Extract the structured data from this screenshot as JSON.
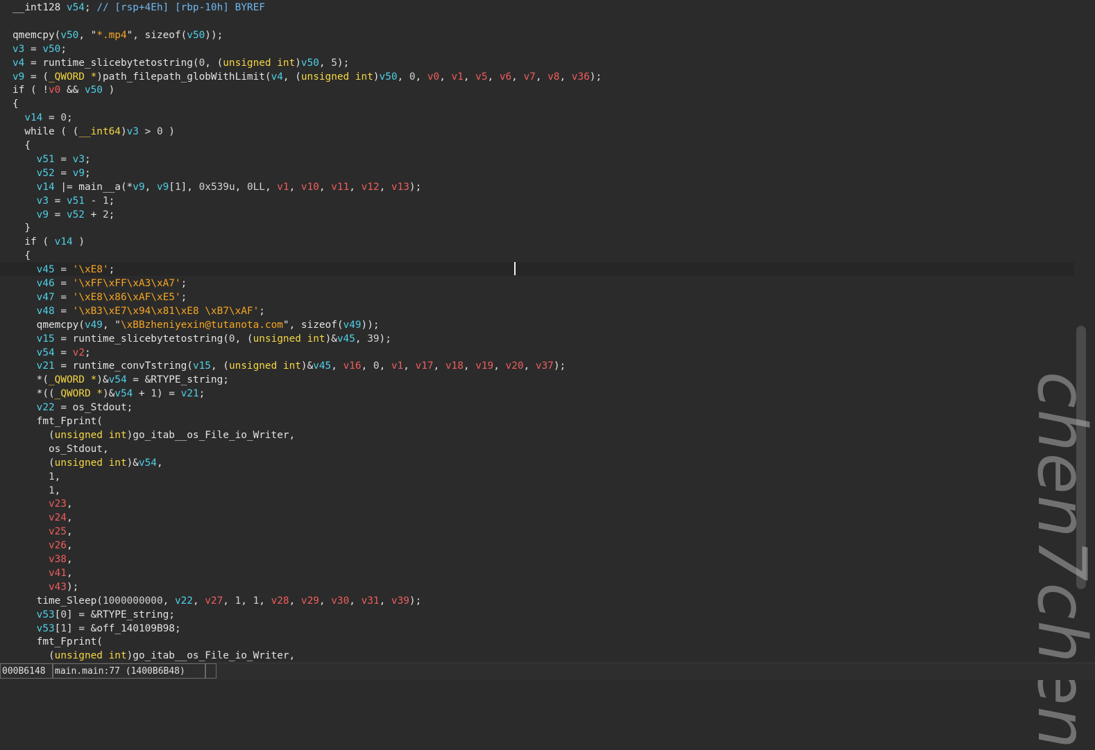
{
  "editor": {
    "lines": [
      [
        [
          "t-plain",
          "__int128 "
        ],
        [
          "t-local",
          "v54"
        ],
        [
          "t-plain",
          "; "
        ],
        [
          "t-cmt",
          "// [rsp+4Eh] [rbp-10h] BYREF"
        ]
      ],
      [],
      [
        [
          "t-plain",
          "qmemcpy("
        ],
        [
          "t-local",
          "v50"
        ],
        [
          "t-plain",
          ", \""
        ],
        [
          "t-str",
          "*.mp4"
        ],
        [
          "t-plain",
          "\", sizeof("
        ],
        [
          "t-local",
          "v50"
        ],
        [
          "t-plain",
          "));"
        ]
      ],
      [
        [
          "t-local",
          "v3"
        ],
        [
          "t-plain",
          " = "
        ],
        [
          "t-local",
          "v50"
        ],
        [
          "t-plain",
          ";"
        ]
      ],
      [
        [
          "t-local",
          "v4"
        ],
        [
          "t-plain",
          " = runtime_slicebytetostring("
        ],
        [
          "t-num",
          "0"
        ],
        [
          "t-plain",
          ", ("
        ],
        [
          "t-type",
          "unsigned int"
        ],
        [
          "t-plain",
          ")"
        ],
        [
          "t-local",
          "v50"
        ],
        [
          "t-plain",
          ", "
        ],
        [
          "t-num",
          "5"
        ],
        [
          "t-plain",
          ");"
        ]
      ],
      [
        [
          "t-local",
          "v9"
        ],
        [
          "t-plain",
          " = ("
        ],
        [
          "t-type",
          "_QWORD *"
        ],
        [
          "t-plain",
          ")path_filepath_globWithLimit("
        ],
        [
          "t-local",
          "v4"
        ],
        [
          "t-plain",
          ", ("
        ],
        [
          "t-type",
          "unsigned int"
        ],
        [
          "t-plain",
          ")"
        ],
        [
          "t-local",
          "v50"
        ],
        [
          "t-plain",
          ", "
        ],
        [
          "t-num",
          "0"
        ],
        [
          "t-plain",
          ", "
        ],
        [
          "t-arg",
          "v0"
        ],
        [
          "t-plain",
          ", "
        ],
        [
          "t-arg",
          "v1"
        ],
        [
          "t-plain",
          ", "
        ],
        [
          "t-arg",
          "v5"
        ],
        [
          "t-plain",
          ", "
        ],
        [
          "t-arg",
          "v6"
        ],
        [
          "t-plain",
          ", "
        ],
        [
          "t-arg",
          "v7"
        ],
        [
          "t-plain",
          ", "
        ],
        [
          "t-arg",
          "v8"
        ],
        [
          "t-plain",
          ", "
        ],
        [
          "t-arg",
          "v36"
        ],
        [
          "t-plain",
          ");"
        ]
      ],
      [
        [
          "t-plain",
          "if ( !"
        ],
        [
          "t-arg",
          "v0"
        ],
        [
          "t-plain",
          " && "
        ],
        [
          "t-local",
          "v50"
        ],
        [
          "t-plain",
          " )"
        ]
      ],
      [
        [
          "t-plain",
          "{"
        ]
      ],
      [
        [
          "t-plain",
          "  "
        ],
        [
          "t-local",
          "v14"
        ],
        [
          "t-plain",
          " = "
        ],
        [
          "t-num",
          "0"
        ],
        [
          "t-plain",
          ";"
        ]
      ],
      [
        [
          "t-plain",
          "  while ( ("
        ],
        [
          "t-type",
          "__int64"
        ],
        [
          "t-plain",
          ")"
        ],
        [
          "t-local",
          "v3"
        ],
        [
          "t-plain",
          " > "
        ],
        [
          "t-num",
          "0"
        ],
        [
          "t-plain",
          " )"
        ]
      ],
      [
        [
          "t-plain",
          "  {"
        ]
      ],
      [
        [
          "t-plain",
          "    "
        ],
        [
          "t-local",
          "v51"
        ],
        [
          "t-plain",
          " = "
        ],
        [
          "t-local",
          "v3"
        ],
        [
          "t-plain",
          ";"
        ]
      ],
      [
        [
          "t-plain",
          "    "
        ],
        [
          "t-local",
          "v52"
        ],
        [
          "t-plain",
          " = "
        ],
        [
          "t-local",
          "v9"
        ],
        [
          "t-plain",
          ";"
        ]
      ],
      [
        [
          "t-plain",
          "    "
        ],
        [
          "t-local",
          "v14"
        ],
        [
          "t-plain",
          " |= main__a(*"
        ],
        [
          "t-local",
          "v9"
        ],
        [
          "t-plain",
          ", "
        ],
        [
          "t-local",
          "v9"
        ],
        [
          "t-plain",
          "["
        ],
        [
          "t-num",
          "1"
        ],
        [
          "t-plain",
          "], "
        ],
        [
          "t-num",
          "0x539u"
        ],
        [
          "t-plain",
          ", "
        ],
        [
          "t-num",
          "0LL"
        ],
        [
          "t-plain",
          ", "
        ],
        [
          "t-arg",
          "v1"
        ],
        [
          "t-plain",
          ", "
        ],
        [
          "t-arg",
          "v10"
        ],
        [
          "t-plain",
          ", "
        ],
        [
          "t-arg",
          "v11"
        ],
        [
          "t-plain",
          ", "
        ],
        [
          "t-arg",
          "v12"
        ],
        [
          "t-plain",
          ", "
        ],
        [
          "t-arg",
          "v13"
        ],
        [
          "t-plain",
          ");"
        ]
      ],
      [
        [
          "t-plain",
          "    "
        ],
        [
          "t-local",
          "v3"
        ],
        [
          "t-plain",
          " = "
        ],
        [
          "t-local",
          "v51"
        ],
        [
          "t-plain",
          " - "
        ],
        [
          "t-num",
          "1"
        ],
        [
          "t-plain",
          ";"
        ]
      ],
      [
        [
          "t-plain",
          "    "
        ],
        [
          "t-local",
          "v9"
        ],
        [
          "t-plain",
          " = "
        ],
        [
          "t-local",
          "v52"
        ],
        [
          "t-plain",
          " + "
        ],
        [
          "t-num",
          "2"
        ],
        [
          "t-plain",
          ";"
        ]
      ],
      [
        [
          "t-plain",
          "  }"
        ]
      ],
      [
        [
          "t-plain",
          "  if ( "
        ],
        [
          "t-local",
          "v14"
        ],
        [
          "t-plain",
          " )"
        ]
      ],
      [
        [
          "t-plain",
          "  {"
        ]
      ],
      [
        [
          "t-plain",
          "    "
        ],
        [
          "t-local",
          "v45"
        ],
        [
          "t-plain",
          " = "
        ],
        [
          "t-str",
          "'\\xE8'"
        ],
        [
          "t-plain",
          ";"
        ]
      ],
      [
        [
          "t-plain",
          "    "
        ],
        [
          "t-local",
          "v46"
        ],
        [
          "t-plain",
          " = "
        ],
        [
          "t-str",
          "'\\xFF\\xFF\\xA3\\xA7'"
        ],
        [
          "t-plain",
          ";"
        ]
      ],
      [
        [
          "t-plain",
          "    "
        ],
        [
          "t-local",
          "v47"
        ],
        [
          "t-plain",
          " = "
        ],
        [
          "t-str",
          "'\\xE8\\x86\\xAF\\xE5'"
        ],
        [
          "t-plain",
          ";"
        ]
      ],
      [
        [
          "t-plain",
          "    "
        ],
        [
          "t-local",
          "v48"
        ],
        [
          "t-plain",
          " = "
        ],
        [
          "t-str",
          "'\\xB3\\xE7\\x94\\x81\\xE8 \\xB7\\xAF'"
        ],
        [
          "t-plain",
          ";"
        ]
      ],
      [
        [
          "t-plain",
          "    qmemcpy("
        ],
        [
          "t-local",
          "v49"
        ],
        [
          "t-plain",
          ", \""
        ],
        [
          "t-str",
          "\\xBBzheniyexin@tutanota.com"
        ],
        [
          "t-plain",
          "\", sizeof("
        ],
        [
          "t-local",
          "v49"
        ],
        [
          "t-plain",
          "));"
        ]
      ],
      [
        [
          "t-plain",
          "    "
        ],
        [
          "t-local",
          "v15"
        ],
        [
          "t-plain",
          " = runtime_slicebytetostring("
        ],
        [
          "t-num",
          "0"
        ],
        [
          "t-plain",
          ", ("
        ],
        [
          "t-type",
          "unsigned int"
        ],
        [
          "t-plain",
          ")&"
        ],
        [
          "t-local",
          "v45"
        ],
        [
          "t-plain",
          ", "
        ],
        [
          "t-num",
          "39"
        ],
        [
          "t-plain",
          ");"
        ]
      ],
      [
        [
          "t-plain",
          "    "
        ],
        [
          "t-local",
          "v54"
        ],
        [
          "t-plain",
          " = "
        ],
        [
          "t-arg",
          "v2"
        ],
        [
          "t-plain",
          ";"
        ]
      ],
      [
        [
          "t-plain",
          "    "
        ],
        [
          "t-local",
          "v21"
        ],
        [
          "t-plain",
          " = runtime_convTstring("
        ],
        [
          "t-local",
          "v15"
        ],
        [
          "t-plain",
          ", ("
        ],
        [
          "t-type",
          "unsigned int"
        ],
        [
          "t-plain",
          ")&"
        ],
        [
          "t-local",
          "v45"
        ],
        [
          "t-plain",
          ", "
        ],
        [
          "t-arg",
          "v16"
        ],
        [
          "t-plain",
          ", "
        ],
        [
          "t-num",
          "0"
        ],
        [
          "t-plain",
          ", "
        ],
        [
          "t-arg",
          "v1"
        ],
        [
          "t-plain",
          ", "
        ],
        [
          "t-arg",
          "v17"
        ],
        [
          "t-plain",
          ", "
        ],
        [
          "t-arg",
          "v18"
        ],
        [
          "t-plain",
          ", "
        ],
        [
          "t-arg",
          "v19"
        ],
        [
          "t-plain",
          ", "
        ],
        [
          "t-arg",
          "v20"
        ],
        [
          "t-plain",
          ", "
        ],
        [
          "t-arg",
          "v37"
        ],
        [
          "t-plain",
          ");"
        ]
      ],
      [
        [
          "t-plain",
          "    *("
        ],
        [
          "t-type",
          "_QWORD *"
        ],
        [
          "t-plain",
          ")&"
        ],
        [
          "t-local",
          "v54"
        ],
        [
          "t-plain",
          " = &RTYPE_string;"
        ]
      ],
      [
        [
          "t-plain",
          "    *(("
        ],
        [
          "t-type",
          "_QWORD *"
        ],
        [
          "t-plain",
          ")&"
        ],
        [
          "t-local",
          "v54"
        ],
        [
          "t-plain",
          " + "
        ],
        [
          "t-num",
          "1"
        ],
        [
          "t-plain",
          ") = "
        ],
        [
          "t-local",
          "v21"
        ],
        [
          "t-plain",
          ";"
        ]
      ],
      [
        [
          "t-plain",
          "    "
        ],
        [
          "t-local",
          "v22"
        ],
        [
          "t-plain",
          " = os_Stdout;"
        ]
      ],
      [
        [
          "t-plain",
          "    fmt_Fprint("
        ]
      ],
      [
        [
          "t-plain",
          "      ("
        ],
        [
          "t-type",
          "unsigned int"
        ],
        [
          "t-plain",
          ")go_itab__os_File_io_Writer,"
        ]
      ],
      [
        [
          "t-plain",
          "      os_Stdout,"
        ]
      ],
      [
        [
          "t-plain",
          "      ("
        ],
        [
          "t-type",
          "unsigned int"
        ],
        [
          "t-plain",
          ")&"
        ],
        [
          "t-local",
          "v54"
        ],
        [
          "t-plain",
          ","
        ]
      ],
      [
        [
          "t-plain",
          "      "
        ],
        [
          "t-num",
          "1"
        ],
        [
          "t-plain",
          ","
        ]
      ],
      [
        [
          "t-plain",
          "      "
        ],
        [
          "t-num",
          "1"
        ],
        [
          "t-plain",
          ","
        ]
      ],
      [
        [
          "t-plain",
          "      "
        ],
        [
          "t-arg",
          "v23"
        ],
        [
          "t-plain",
          ","
        ]
      ],
      [
        [
          "t-plain",
          "      "
        ],
        [
          "t-arg",
          "v24"
        ],
        [
          "t-plain",
          ","
        ]
      ],
      [
        [
          "t-plain",
          "      "
        ],
        [
          "t-arg",
          "v25"
        ],
        [
          "t-plain",
          ","
        ]
      ],
      [
        [
          "t-plain",
          "      "
        ],
        [
          "t-arg",
          "v26"
        ],
        [
          "t-plain",
          ","
        ]
      ],
      [
        [
          "t-plain",
          "      "
        ],
        [
          "t-arg",
          "v38"
        ],
        [
          "t-plain",
          ","
        ]
      ],
      [
        [
          "t-plain",
          "      "
        ],
        [
          "t-arg",
          "v41"
        ],
        [
          "t-plain",
          ","
        ]
      ],
      [
        [
          "t-plain",
          "      "
        ],
        [
          "t-arg",
          "v43"
        ],
        [
          "t-plain",
          ");"
        ]
      ],
      [
        [
          "t-plain",
          "    time_Sleep("
        ],
        [
          "t-num",
          "1000000000"
        ],
        [
          "t-plain",
          ", "
        ],
        [
          "t-local",
          "v22"
        ],
        [
          "t-plain",
          ", "
        ],
        [
          "t-arg",
          "v27"
        ],
        [
          "t-plain",
          ", "
        ],
        [
          "t-num",
          "1"
        ],
        [
          "t-plain",
          ", "
        ],
        [
          "t-num",
          "1"
        ],
        [
          "t-plain",
          ", "
        ],
        [
          "t-arg",
          "v28"
        ],
        [
          "t-plain",
          ", "
        ],
        [
          "t-arg",
          "v29"
        ],
        [
          "t-plain",
          ", "
        ],
        [
          "t-arg",
          "v30"
        ],
        [
          "t-plain",
          ", "
        ],
        [
          "t-arg",
          "v31"
        ],
        [
          "t-plain",
          ", "
        ],
        [
          "t-arg",
          "v39"
        ],
        [
          "t-plain",
          ");"
        ]
      ],
      [
        [
          "t-plain",
          "    "
        ],
        [
          "t-local",
          "v53"
        ],
        [
          "t-plain",
          "["
        ],
        [
          "t-num",
          "0"
        ],
        [
          "t-plain",
          "] = &RTYPE_string;"
        ]
      ],
      [
        [
          "t-plain",
          "    "
        ],
        [
          "t-local",
          "v53"
        ],
        [
          "t-plain",
          "["
        ],
        [
          "t-num",
          "1"
        ],
        [
          "t-plain",
          "] = &off_140109B98;"
        ]
      ],
      [
        [
          "t-plain",
          "    fmt_Fprint("
        ]
      ],
      [
        [
          "t-plain",
          "      ("
        ],
        [
          "t-type",
          "unsigned int"
        ],
        [
          "t-plain",
          ")go_itab__os_File_io_Writer,"
        ]
      ]
    ],
    "current_line_index": 19
  },
  "watermark": {
    "text": "chen7chen"
  },
  "status_bar": {
    "address": "000B6148",
    "location": "main.main:77 (1400B6B48)"
  },
  "colors": {
    "background": "#2b2b2b",
    "plain": "#e4e4e4",
    "local_var": "#4fd0e6",
    "arg_var": "#f05d5d",
    "string": "#f5a623",
    "type": "#f6d743",
    "comment": "#6fb8f0"
  }
}
